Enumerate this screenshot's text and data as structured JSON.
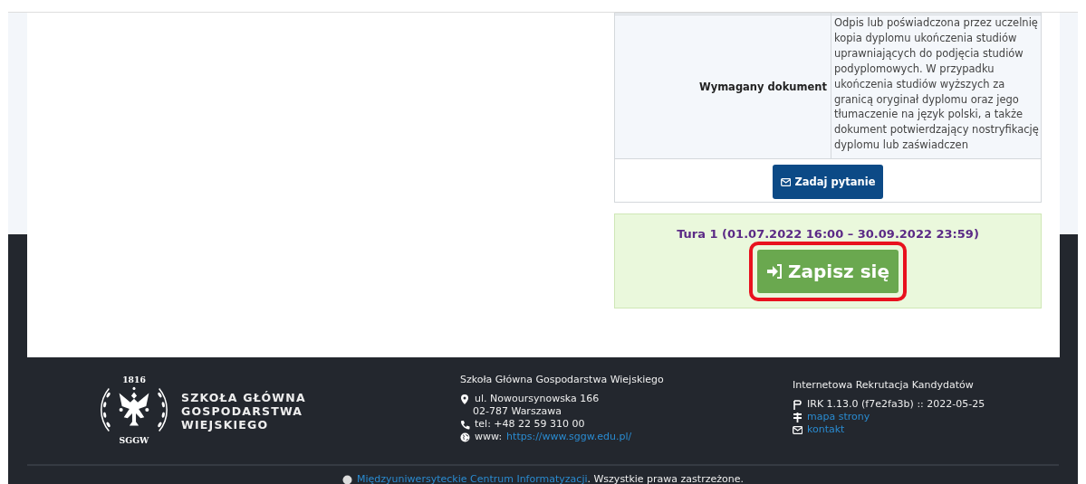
{
  "details_table": {
    "rows": [
      {
        "label": "Wymagany dokument",
        "value": "Odpis lub poświadczona przez uczelnię kopia dyplomu ukończenia studiów uprawniających do podjęcia studiów podyplomowych. W przypadku ukończenia studiów wyższych za granicą oryginał dyplomu oraz jego tłumaczenie na język polski, a także dokument potwierdzający nostryfikację dyplomu lub zaświadczen"
      }
    ],
    "ask_button": "Zadaj pytanie"
  },
  "enrollment": {
    "round": "Tura 1 (01.07.2022 16:00 – 30.09.2022 23:59)",
    "signup_button": "Zapisz się",
    "highlighted": true
  },
  "footer": {
    "logo": {
      "year": "1816",
      "initials": "SGGW",
      "name_lines": [
        "SZKOŁA GŁÓWNA",
        "GOSPODARSTWA",
        "WIEJSKIEGO"
      ]
    },
    "address": {
      "title": "Szkoła Główna Gospodarstwa Wiejskiego",
      "street": "ul. Nowoursynowska 166",
      "city": "02-787 Warszawa",
      "phone": "tel: +48 22 59 310 00",
      "www_label": "www:",
      "www_link": "https://www.sggw.edu.pl/"
    },
    "system": {
      "title": "Internetowa Rekrutacja Kandydatów",
      "version": "IRK 1.13.0 (f7e2fa3b) :: 2022-05-25",
      "sitemap_link": "mapa strony",
      "contact_link": "kontakt"
    },
    "copyright": {
      "link": "Międzyuniwersyteckie Centrum Informatyzacji",
      "text": ". Wszystkie prawa zastrzeżone."
    }
  }
}
